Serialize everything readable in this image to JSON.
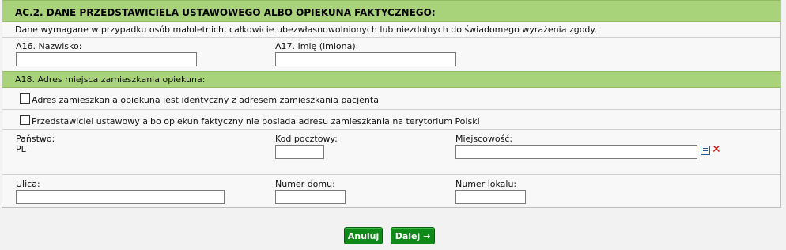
{
  "section": {
    "title": "AC.2. DANE PRZEDSTAWICIELA USTAWOWEGO ALBO OPIEKUNA FAKTYCZNEGO:",
    "note": "Dane wymagane w przypadku osób małoletnich, całkowicie ubezwłasnowolnionych lub niezdolnych do świadomego wyrażenia zgody."
  },
  "fields": {
    "surname_label": "A16. Nazwisko:",
    "surname_value": "",
    "firstname_label": "A17. Imię (imiona):",
    "firstname_value": ""
  },
  "address": {
    "title": "A18. Adres miejsca zamieszkania opiekuna:",
    "checkbox_same": "Adres zamieszkania opiekuna jest identyczny z adresem zamieszkania pacjenta",
    "checkbox_no_address": "Przedstawiciel ustawowy albo opiekun faktyczny nie posiada adresu zamieszkania na terytorium Polski",
    "country_label": "Państwo:",
    "country_value": "PL",
    "postal_label": "Kod pocztowy:",
    "city_label": "Miejscowość:",
    "street_label": "Ulica:",
    "house_label": "Numer domu:",
    "apartment_label": "Numer lokalu:"
  },
  "buttons": {
    "cancel": "Anuluj",
    "next": "Dalej →"
  },
  "colors": {
    "header_green": "#a9d37a",
    "button_green": "#0f8a18"
  }
}
